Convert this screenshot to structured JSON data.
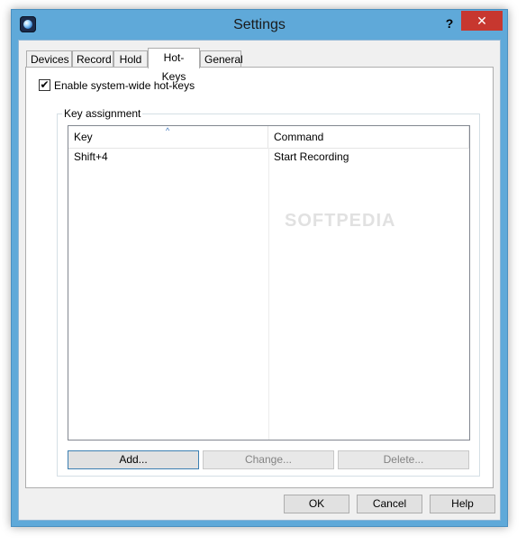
{
  "window": {
    "title": "Settings",
    "help_glyph": "?",
    "close_glyph": "✕"
  },
  "tabs": [
    {
      "label": "Devices",
      "active": false
    },
    {
      "label": "Record",
      "active": false
    },
    {
      "label": "Hold",
      "active": false
    },
    {
      "label": "Hot-Keys",
      "active": true
    },
    {
      "label": "General",
      "active": false
    }
  ],
  "hotkeys": {
    "enable_checkbox": {
      "label": "Enable system-wide hot-keys",
      "checked": true,
      "glyph": "✔"
    },
    "group_label": "Key assignment",
    "columns": [
      "Key",
      "Command"
    ],
    "sort_glyph": "^",
    "rows": [
      {
        "key": "Shift+4",
        "command": "Start Recording"
      }
    ],
    "buttons": {
      "add": "Add...",
      "change": "Change...",
      "delete": "Delete..."
    }
  },
  "footer": {
    "ok": "OK",
    "cancel": "Cancel",
    "help": "Help"
  },
  "watermark": "SOFTPEDIA"
}
